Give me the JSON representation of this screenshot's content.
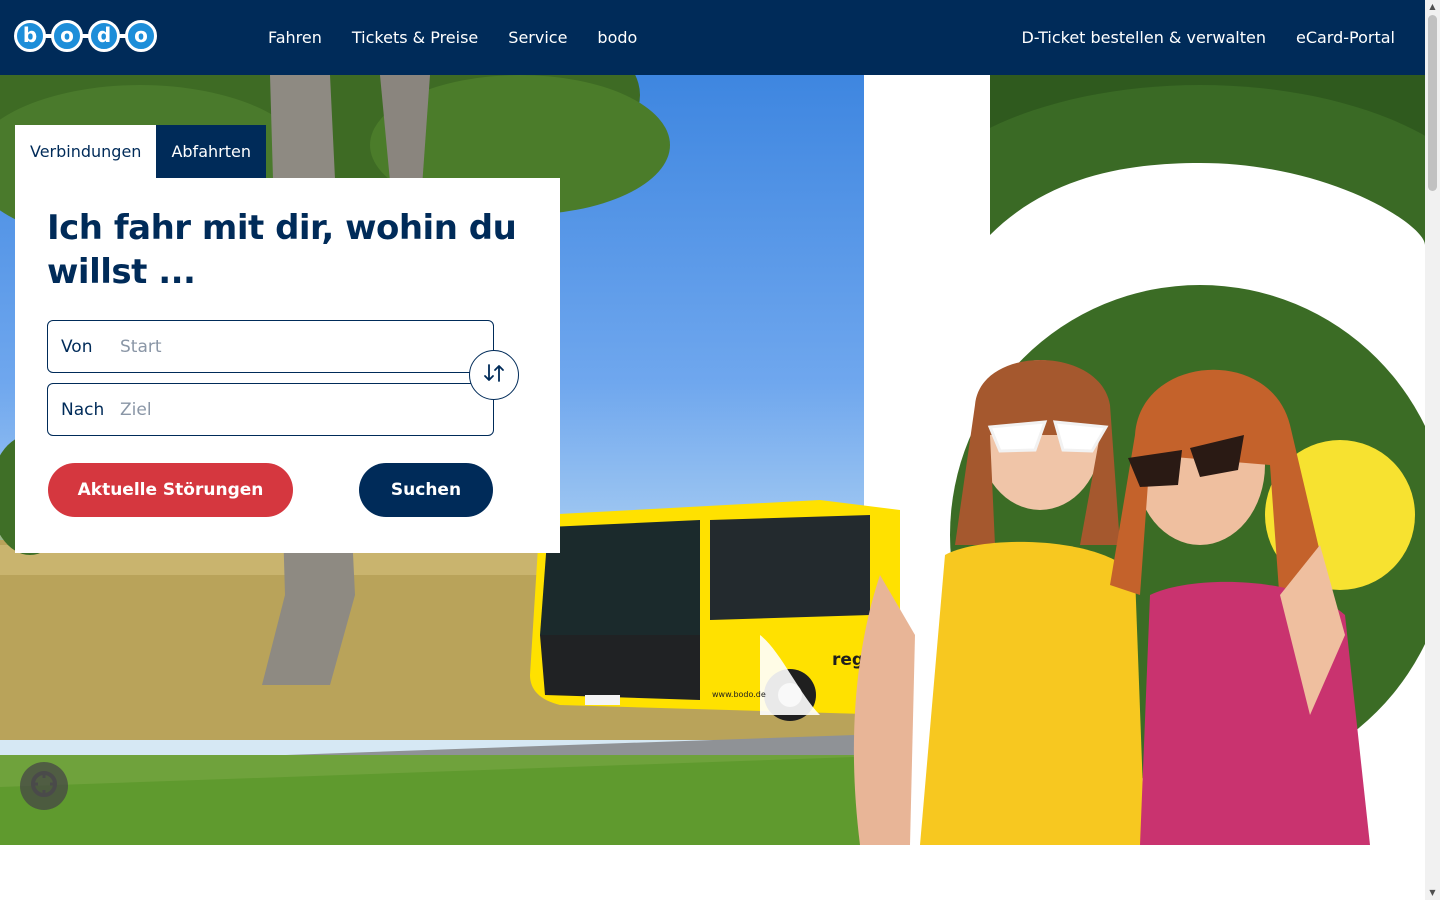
{
  "header": {
    "logo_letters": [
      "b",
      "o",
      "d",
      "o"
    ],
    "nav": [
      "Fahren",
      "Tickets & Preise",
      "Service",
      "bodo"
    ],
    "nav_right": [
      "D-Ticket bestellen & verwalten",
      "eCard-Portal"
    ]
  },
  "search": {
    "tabs": [
      "Verbindungen",
      "Abfahrten"
    ],
    "active_tab": "Verbindungen",
    "title": "Ich fahr mit dir, wohin du willst ...",
    "from_label": "Von",
    "from_placeholder": "Start",
    "from_value": "",
    "to_label": "Nach",
    "to_placeholder": "Ziel",
    "to_value": "",
    "disruptions_button": "Aktuelle Störungen",
    "search_button": "Suchen"
  },
  "hero": {
    "bus_signage": "regional",
    "bus_website": "www.bodo.de"
  },
  "colors": {
    "navy": "#002b59",
    "logo_blue": "#1d8ed9",
    "red": "#d5373f",
    "yellow": "#f7e230"
  },
  "icons": {
    "swap": "swap-arrows-icon",
    "privacy": "privacy-settings-icon"
  }
}
